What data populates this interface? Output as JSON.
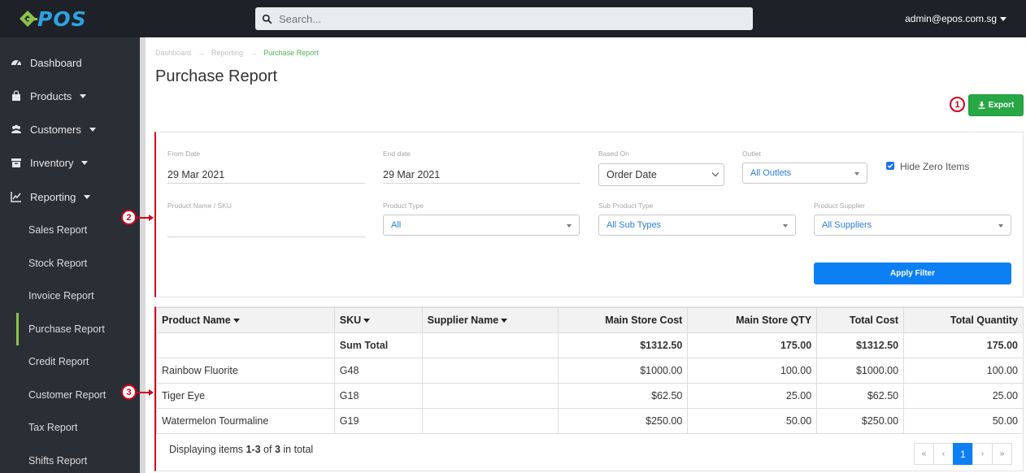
{
  "app": {
    "logo_text": "POS",
    "brand_color": "#2ea3e3",
    "logo_leaf_color": "#8bc34a"
  },
  "search": {
    "placeholder": "Search..."
  },
  "user": {
    "email": "admin@epos.com.sg"
  },
  "sidebar": {
    "items": [
      {
        "label": "Dashboard",
        "icon": "dashboard-icon"
      },
      {
        "label": "Products",
        "icon": "bag-icon"
      },
      {
        "label": "Customers",
        "icon": "users-icon"
      },
      {
        "label": "Inventory",
        "icon": "inventory-icon"
      },
      {
        "label": "Reporting",
        "icon": "chart-line-icon"
      }
    ],
    "reporting_sub": [
      "Sales Report",
      "Stock Report",
      "Invoice Report",
      "Purchase Report",
      "Credit Report",
      "Customer Report",
      "Tax Report",
      "Shifts Report"
    ]
  },
  "breadcrumb": [
    "Dashboard",
    "Reporting",
    "Purchase Report"
  ],
  "page_title": "Purchase Report",
  "export_label": "Export",
  "markers": [
    "1",
    "2",
    "3"
  ],
  "filters": {
    "from_date": {
      "label": "From Date",
      "value": "29 Mar 2021"
    },
    "end_date": {
      "label": "End date",
      "value": "29 Mar 2021"
    },
    "based_on": {
      "label": "Based On",
      "value": "Order Date"
    },
    "outlet": {
      "label": "Outlet",
      "value": "All Outlets"
    },
    "hide_zero": {
      "label": "Hide Zero Items",
      "checked": true
    },
    "product_name": {
      "label": "Product Name / SKU",
      "value": ""
    },
    "product_type": {
      "label": "Product Type",
      "value": "All"
    },
    "sub_product_type": {
      "label": "Sub Product Type",
      "value": "All Sub Types"
    },
    "product_supplier": {
      "label": "Product Supplier",
      "value": "All Suppliers"
    },
    "apply_label": "Apply Filter"
  },
  "table": {
    "headers": [
      "Product Name",
      "SKU",
      "Supplier Name",
      "Main Store Cost",
      "Main Store QTY",
      "Total Cost",
      "Total Quantity"
    ],
    "sum_row": [
      "",
      "Sum Total",
      "",
      "$1312.50",
      "175.00",
      "$1312.50",
      "175.00"
    ],
    "rows": [
      [
        "Rainbow Fluorite",
        "G48",
        "",
        "$1000.00",
        "100.00",
        "$1000.00",
        "100.00"
      ],
      [
        "Tiger Eye",
        "G18",
        "",
        "$62.50",
        "25.00",
        "$62.50",
        "25.00"
      ],
      [
        "Watermelon Tourmaline",
        "G19",
        "",
        "$250.00",
        "50.00",
        "$250.00",
        "50.00"
      ]
    ]
  },
  "summary": {
    "prefix": "Displaying items ",
    "range": "1-3",
    "of": " of ",
    "total": "3",
    "suffix": " in total"
  },
  "pager": [
    "«",
    "‹",
    "1",
    "›",
    "»"
  ]
}
